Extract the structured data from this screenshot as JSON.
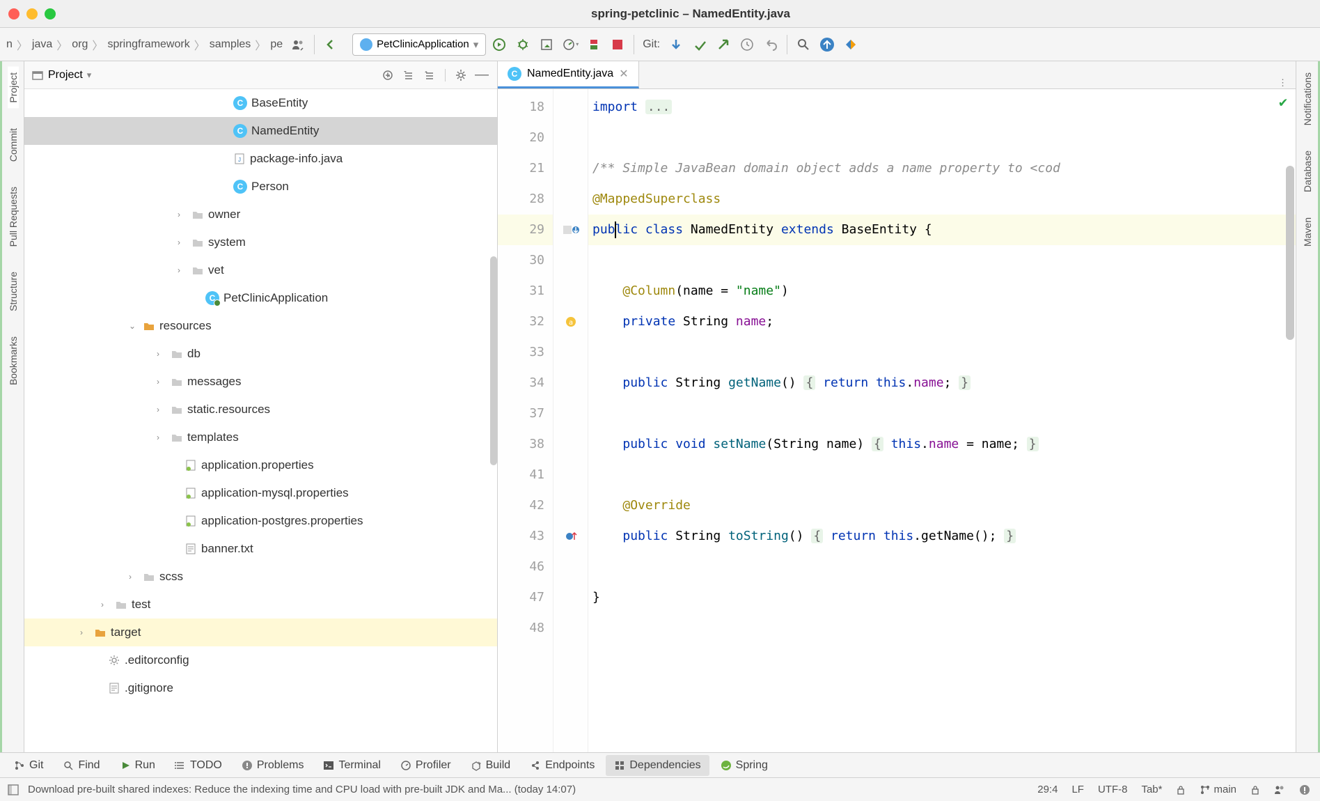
{
  "window": {
    "title": "spring-petclinic – NamedEntity.java"
  },
  "breadcrumb": [
    "n",
    "java",
    "org",
    "springframework",
    "samples",
    "pe"
  ],
  "run_config": "PetClinicApplication",
  "git_label": "Git:",
  "sidebar": {
    "title": "Project",
    "items": [
      {
        "indent": 280,
        "icon": "class",
        "label": "BaseEntity"
      },
      {
        "indent": 280,
        "icon": "class",
        "label": "NamedEntity",
        "selected": true
      },
      {
        "indent": 280,
        "icon": "jfile",
        "label": "package-info.java"
      },
      {
        "indent": 280,
        "icon": "class",
        "label": "Person"
      },
      {
        "indent": 220,
        "icon": "folder",
        "label": "owner",
        "chev": ">"
      },
      {
        "indent": 220,
        "icon": "folder",
        "label": "system",
        "chev": ">"
      },
      {
        "indent": 220,
        "icon": "folder",
        "label": "vet",
        "chev": ">"
      },
      {
        "indent": 240,
        "icon": "app",
        "label": "PetClinicApplication"
      },
      {
        "indent": 150,
        "icon": "folder-y",
        "label": "resources",
        "chev": "v"
      },
      {
        "indent": 190,
        "icon": "folder",
        "label": "db",
        "chev": ">"
      },
      {
        "indent": 190,
        "icon": "folder",
        "label": "messages",
        "chev": ">"
      },
      {
        "indent": 190,
        "icon": "folder",
        "label": "static.resources",
        "chev": ">"
      },
      {
        "indent": 190,
        "icon": "folder",
        "label": "templates",
        "chev": ">"
      },
      {
        "indent": 210,
        "icon": "props",
        "label": "application.properties"
      },
      {
        "indent": 210,
        "icon": "props",
        "label": "application-mysql.properties"
      },
      {
        "indent": 210,
        "icon": "props",
        "label": "application-postgres.properties"
      },
      {
        "indent": 210,
        "icon": "txt",
        "label": "banner.txt"
      },
      {
        "indent": 150,
        "icon": "folder",
        "label": "scss",
        "chev": ">"
      },
      {
        "indent": 110,
        "icon": "folder",
        "label": "test",
        "chev": ">"
      },
      {
        "indent": 80,
        "icon": "folder-y",
        "label": "target",
        "chev": ">",
        "highlighted": true
      },
      {
        "indent": 100,
        "icon": "gear",
        "label": ".editorconfig"
      },
      {
        "indent": 100,
        "icon": "txt",
        "label": ".gitignore"
      }
    ]
  },
  "editor": {
    "tab": "NamedEntity.java",
    "gutter_lines": [
      "18",
      "20",
      "21",
      "28",
      "29",
      "30",
      "31",
      "32",
      "33",
      "34",
      "37",
      "38",
      "41",
      "42",
      "43",
      "46",
      "47",
      "48"
    ],
    "highlighted_line": "29",
    "code_lines": [
      {
        "n": "18",
        "html": "<span class='kw'>import</span> <span class='fold-hint'>...</span>"
      },
      {
        "n": "20",
        "html": ""
      },
      {
        "n": "21",
        "html": "<span class='cm'>/** Simple JavaBean domain object adds a name property to &lt;cod</span>"
      },
      {
        "n": "28",
        "html": "<span class='ann'>@MappedSuperclass</span>"
      },
      {
        "n": "29",
        "html": "<span class='kw'>pub<span class='caret'></span>lic class</span> NamedEntity <span class='kw'>extends</span> BaseEntity {",
        "hl": true
      },
      {
        "n": "30",
        "html": ""
      },
      {
        "n": "31",
        "html": "    <span class='ann'>@Column</span>(name = <span class='str'>\"name\"</span>)"
      },
      {
        "n": "32",
        "html": "    <span class='kw'>private</span> String <span class='fld'>name</span>;"
      },
      {
        "n": "33",
        "html": ""
      },
      {
        "n": "34",
        "html": "    <span class='kw'>public</span> String <span class='fn'>getName</span>() <span class='fold-hint'>{</span> <span class='kw'>return this</span>.<span class='fld'>name</span>; <span class='fold-hint'>}</span>"
      },
      {
        "n": "37",
        "html": ""
      },
      {
        "n": "38",
        "html": "    <span class='kw'>public void</span> <span class='fn'>setName</span>(String name) <span class='fold-hint'>{</span> <span class='kw'>this</span>.<span class='fld'>name</span> = name; <span class='fold-hint'>}</span>"
      },
      {
        "n": "41",
        "html": ""
      },
      {
        "n": "42",
        "html": "    <span class='ann'>@Override</span>"
      },
      {
        "n": "43",
        "html": "    <span class='kw'>public</span> String <span class='fn'>toString</span>() <span class='fold-hint'>{</span> <span class='kw'>return this</span>.getName(); <span class='fold-hint'>}</span>"
      },
      {
        "n": "46",
        "html": ""
      },
      {
        "n": "47",
        "html": "}"
      },
      {
        "n": "48",
        "html": ""
      }
    ]
  },
  "left_rail": [
    "Project",
    "Commit",
    "Pull Requests",
    "Structure",
    "Bookmarks"
  ],
  "right_rail": [
    "Notifications",
    "Database",
    "Maven"
  ],
  "bottom_tabs": [
    {
      "icon": "git",
      "label": "Git"
    },
    {
      "icon": "search",
      "label": "Find"
    },
    {
      "icon": "play",
      "label": "Run"
    },
    {
      "icon": "todo",
      "label": "TODO"
    },
    {
      "icon": "warn",
      "label": "Problems"
    },
    {
      "icon": "term",
      "label": "Terminal"
    },
    {
      "icon": "prof",
      "label": "Profiler"
    },
    {
      "icon": "build",
      "label": "Build"
    },
    {
      "icon": "ep",
      "label": "Endpoints"
    },
    {
      "icon": "dep",
      "label": "Dependencies",
      "active": true
    },
    {
      "icon": "spring",
      "label": "Spring"
    }
  ],
  "statusbar": {
    "msg": "Download pre-built shared indexes: Reduce the indexing time and CPU load with pre-built JDK and Ma... (today 14:07)",
    "pos": "29:4",
    "sep": "LF",
    "enc": "UTF-8",
    "indent": "Tab*",
    "branch": "main"
  }
}
